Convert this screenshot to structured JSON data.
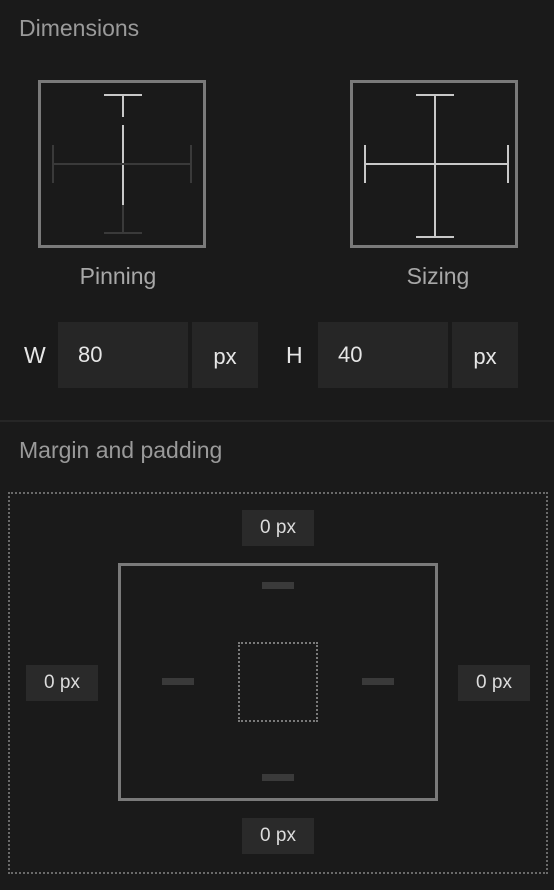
{
  "dimensions": {
    "title": "Dimensions",
    "pinning_label": "Pinning",
    "sizing_label": "Sizing",
    "width_letter": "W",
    "width_value": "80",
    "width_unit": "px",
    "height_letter": "H",
    "height_value": "40",
    "height_unit": "px"
  },
  "margin_padding": {
    "title": "Margin and padding",
    "margin_top": "0 px",
    "margin_left": "0 px",
    "margin_right": "0 px",
    "margin_bottom": "0 px"
  }
}
